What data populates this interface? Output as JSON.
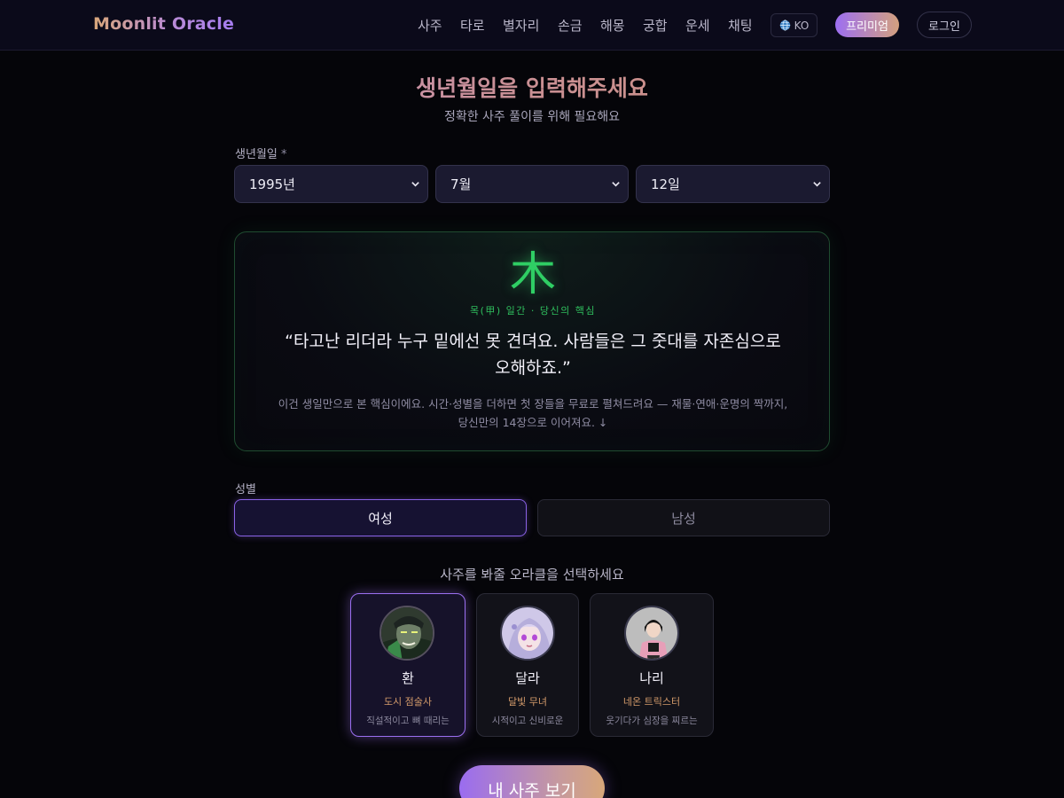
{
  "header": {
    "brand": "Moonlit Oracle",
    "nav": [
      "사주",
      "타로",
      "별자리",
      "손금",
      "해몽",
      "궁합",
      "운세",
      "채팅"
    ],
    "language": "KO",
    "premium_label": "프리미엄",
    "login_label": "로그인"
  },
  "form": {
    "title": "생년월일을 입력해주세요",
    "subtitle": "정확한 사주 풀이를 위해 필요해요",
    "birth_label": "생년월일",
    "required_mark": "*",
    "year": "1995년",
    "month": "7월",
    "day": "12일"
  },
  "core": {
    "glyph": "木",
    "caption": "목(甲) 일간 · 당신의 핵심",
    "quote_line1": "“타고난 리더라 누구 밑에선 못 견뎌요. 사람들은 그 줏대를 자존심으로",
    "quote_line2": "오해하죠.”",
    "desc_line1": "이건 생일만으로 본 핵심이에요. 시간·성별을 더하면 첫 장들을 무료로 펼쳐드려요 — 재물·연애·운명의 짝까지,",
    "desc_line2": "당신만의 14장으로 이어져요. ↓",
    "accent": "#2fce64"
  },
  "gender": {
    "label": "성별",
    "female": "여성",
    "male": "남성",
    "selected": "여성"
  },
  "oracles": {
    "heading": "사주를 봐줄 오라클을 선택하세요",
    "items": [
      {
        "name": "환",
        "role": "도시 점술사",
        "desc": "직설적이고 뼈 때리는"
      },
      {
        "name": "달라",
        "role": "달빛 무녀",
        "desc": "시적이고 신비로운"
      },
      {
        "name": "나리",
        "role": "네온 트릭스터",
        "desc": "웃기다가 심장을 찌르는"
      }
    ],
    "selected": "환"
  },
  "cta_label": "내 사주 보기",
  "colors": {
    "accent_purple": "#9b6ff0",
    "accent_gold": "#d8a77a",
    "background": "#050509"
  }
}
